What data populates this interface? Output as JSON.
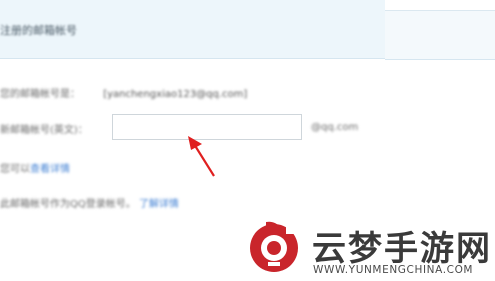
{
  "header": {
    "title": "注册的邮箱帐号"
  },
  "form": {
    "current_label": "您的邮箱帐号是：",
    "current_value": "[yanchengxiao123@qq.com]",
    "new_label": "新邮箱帐号(英文)：",
    "new_value": "",
    "suffix": "@qq.com",
    "tip_prefix": "您可以",
    "tip_link": "查看详情",
    "note_text": "此邮箱帐号作为QQ登录帐号。",
    "note_link": "了解详情"
  },
  "watermark": {
    "title": "云梦手游网",
    "url": "WWW.YUNMENGCHINA.COM",
    "colors": {
      "logo": "#c9252b",
      "text": "#3a3a3a"
    }
  },
  "annotation": {
    "arrow_color": "#e02020"
  }
}
